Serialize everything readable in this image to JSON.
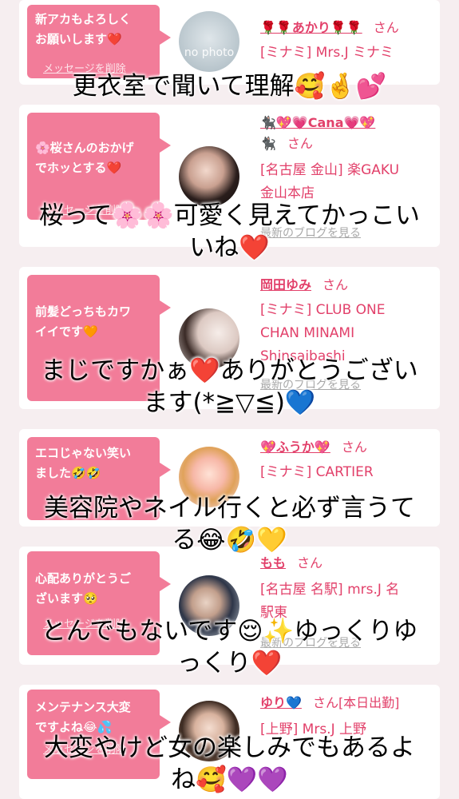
{
  "messages": [
    {
      "bubble_lines": [
        "新アカもよろしく",
        "お願いします❤️"
      ],
      "delete_label": "メッセージを削除",
      "avatar_text": "no photo",
      "name": "🌹🌹あかり🌹🌹",
      "san": "さん",
      "name_extra": "",
      "shop_lines": [
        "[ミナミ] Mrs.J ミナミ"
      ],
      "blog_label": ""
    },
    {
      "bubble_lines": [
        "🌸桜さんのおかげ",
        "でホッとする❤️"
      ],
      "delete_label": "メッセージを削除",
      "avatar_text": "",
      "name": "🐈‍⬛💖💗Cana💗💖",
      "san": "さん",
      "name_extra": "🐈‍⬛",
      "shop_lines": [
        "[名古屋 金山] 楽GAKU",
        "金山本店"
      ],
      "blog_label": "最新のブログを見る"
    },
    {
      "bubble_lines": [
        "前髪どっちもカワ",
        "イイです🧡"
      ],
      "delete_label": "",
      "avatar_text": "",
      "name": "岡田ゆみ",
      "san": "さん",
      "name_extra": "",
      "shop_lines": [
        "[ミナミ] CLUB ONE",
        "CHAN MINAMI",
        "Shinsaibashi"
      ],
      "blog_label": "最新のブログを見る"
    },
    {
      "bubble_lines": [
        "エコじゃない笑い",
        "ました🤣🤣"
      ],
      "delete_label": "",
      "avatar_text": "",
      "name": "💖ふうか💖",
      "san": "さん",
      "name_extra": "",
      "shop_lines": [
        "[ミナミ] CARTIER"
      ],
      "blog_label": ""
    },
    {
      "bubble_lines": [
        "心配ありがとうご",
        "ざいます🥺"
      ],
      "delete_label": "メッセージを削除",
      "avatar_text": "",
      "name": "もも",
      "san": "さん",
      "name_extra": "",
      "shop_lines": [
        "[名古屋 名駅] mrs.J 名",
        "駅東"
      ],
      "blog_label": "最新のブログを見る"
    },
    {
      "bubble_lines": [
        "メンテナンス大変",
        "ですよね😂💦"
      ],
      "delete_label": "メッセージを削除",
      "avatar_text": "",
      "name": "ゆり💙",
      "san": "さん[本日出勤]",
      "name_extra": "",
      "shop_lines": [
        "[上野] Mrs.J 上野"
      ],
      "blog_label": ""
    }
  ],
  "captions": [
    [
      "更衣室で聞いて理解🥰🤞💕"
    ],
    [
      "桜って🌸🌸可愛く見えてかっこい",
      "いね❤️"
    ],
    [
      "まじですかぁ❤️ありがとうござい",
      "ます(*≧▽≦)💙"
    ],
    [
      "美容院やネイル行くと必ず言うて",
      "る😂🤣💛"
    ],
    [
      "とんでもないです😌✨ゆっくりゆ",
      "っくり❤️"
    ],
    [
      "大変やけど女の楽しみでもあるよ",
      "ね🥰💜💜"
    ]
  ]
}
